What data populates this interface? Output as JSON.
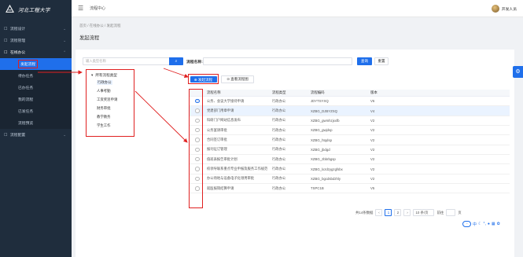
{
  "app": {
    "logo_text": "河北工程大学"
  },
  "sidebar": {
    "items": [
      {
        "label": "流程设计",
        "icon": "flow-icon"
      },
      {
        "label": "流程管理",
        "icon": "manage-icon"
      },
      {
        "label": "在线办公",
        "icon": "office-icon"
      }
    ],
    "sub_items": [
      "发起流程",
      "待办任务",
      "已办任务",
      "我的流程",
      "已发任务",
      "流程预览"
    ],
    "last_item": {
      "label": "流程配置",
      "icon": "config-icon"
    }
  },
  "topbar": {
    "title": "流程中心",
    "user": "开发人员"
  },
  "breadcrumb": "首页 / 在线办公 / 发起流程",
  "page_title": "发起流程",
  "left": {
    "search_placeholder": "输入类型名称",
    "tree_root": "所有流程类型",
    "tree_nodes": [
      "行政办公",
      "人事考勤",
      "工资奖惩申请",
      "财务审批",
      "教学教务",
      "学生工作"
    ]
  },
  "filter": {
    "label": "流程名称:",
    "search": "查询",
    "reset": "重置"
  },
  "actions": {
    "start": "发起流程",
    "diagram": "查看流程图"
  },
  "table": {
    "headers": [
      "流程名称",
      "流程类型",
      "流程编码",
      "版本"
    ],
    "rows": [
      [
        "公务、会议大学接待申请",
        "行政办公",
        "JDYTSYXQ",
        "V6"
      ],
      [
        "党建部门用章申请",
        "行政办公",
        "XZBG_DJBYZSQ",
        "V4"
      ],
      [
        "科研门户网站信息发布",
        "行政办公",
        "XZBG_gwmhzjxxfb",
        "V2"
      ],
      [
        "公务宴请审批",
        "行政办公",
        "XZBG_gwjdsp",
        "V2"
      ],
      [
        "合同签订审批",
        "行政办公",
        "XZBG_htqdsp",
        "V2"
      ],
      [
        "报刊征订管理",
        "行政办公",
        "XZBG_jbdgd",
        "V2"
      ],
      [
        "值班表报告审批计划",
        "行政办公",
        "XZBG_zbbrbgsp",
        "V2"
      ],
      [
        "校领导联系重点专业申报及服务工作规范",
        "行政办公",
        "XZBG_lxzdzygzgfsbx",
        "V2"
      ],
      [
        "办公场地与设备电子化领用审批",
        "行政办公",
        "XZBG_bgcdsbdzhly",
        "V2"
      ],
      [
        "就医报销结算申请",
        "行政办公",
        "TSPC1B",
        "V5"
      ]
    ]
  },
  "pager": {
    "total_text": "共14条数据",
    "pages": [
      "1",
      "2"
    ],
    "page_size": "10 条/页",
    "goto_label": "前往",
    "page_suffix": "页"
  },
  "colors": {
    "primary": "#1f6feb",
    "sidebar": "#1f2d3d",
    "annotation": "#e02020"
  }
}
